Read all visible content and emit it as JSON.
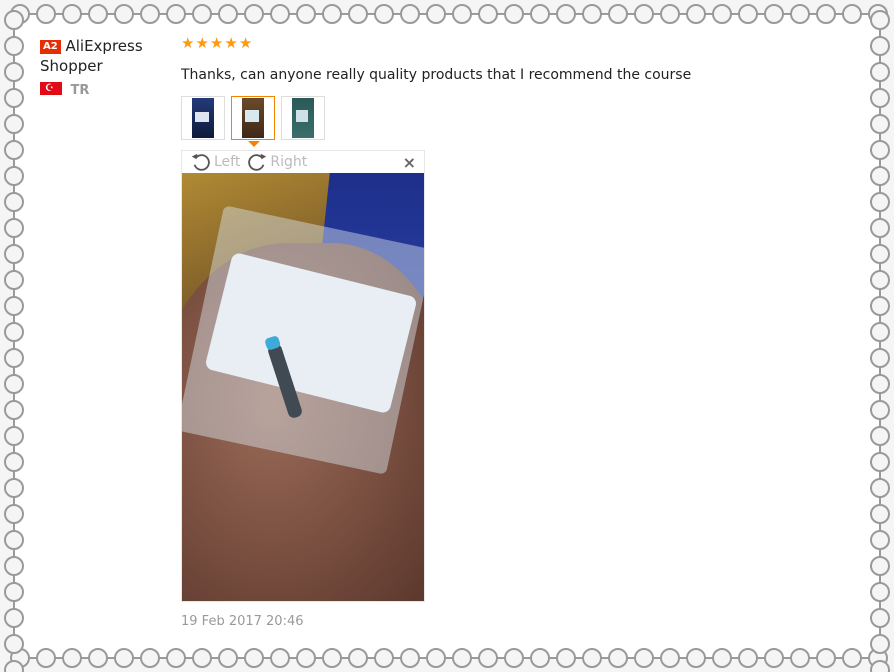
{
  "colors": {
    "accent_orange": "#f48300",
    "star": "#ff9a0e",
    "badge": "#e62e04",
    "muted": "#999999"
  },
  "buyer": {
    "badge": "A2",
    "name": "AliExpress Shopper",
    "country_code": "TR",
    "flag_icon": "turkey-flag-icon"
  },
  "review": {
    "rating": 5,
    "stars": [
      "★",
      "★",
      "★",
      "★",
      "★"
    ],
    "text": "Thanks, can anyone really quality products that I recommend the course",
    "thumbnails": [
      {
        "name": "review-photo-1"
      },
      {
        "name": "review-photo-2",
        "selected": true
      },
      {
        "name": "review-photo-3"
      }
    ],
    "viewer": {
      "rotate_left_label": "Left",
      "rotate_right_label": "Right",
      "close_glyph": "×"
    },
    "date": "19 Feb 2017 20:46"
  }
}
